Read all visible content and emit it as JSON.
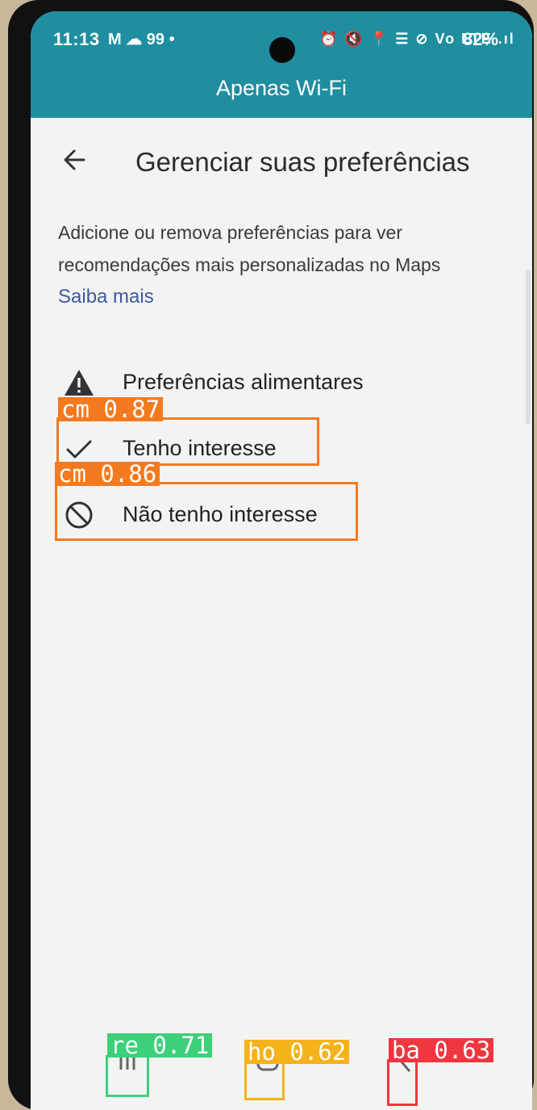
{
  "status_bar": {
    "time": "11:13",
    "notification_icons": "M ☁ 99 •",
    "system_icons": "⏰ 🔇 📍 ☰ ⊘ Vo LTE .ıl",
    "battery": "82%"
  },
  "app_bar": {
    "title": "Apenas Wi-Fi"
  },
  "header": {
    "title": "Gerenciar suas preferências"
  },
  "description": "Adicione ou remova preferências para ver recomendações mais personalizadas no Maps",
  "learn_more": "Saiba mais",
  "section": {
    "title": "Preferências alimentares",
    "icon": "warning-icon"
  },
  "options": [
    {
      "label": "Tenho interesse",
      "icon": "checkmark-icon"
    },
    {
      "label": "Não tenho interesse",
      "icon": "block-icon"
    }
  ],
  "nav_bar": {
    "recents_icon": "recents-icon",
    "home_icon": "home-icon",
    "back_icon": "back-nav-icon"
  },
  "detections": [
    {
      "tag": "cm 0.87",
      "color": "#f47a20"
    },
    {
      "tag": "cm 0.86",
      "color": "#f47a20"
    },
    {
      "tag": "re 0.71",
      "color": "#3dd07a"
    },
    {
      "tag": "ho 0.62",
      "color": "#f5b21b"
    },
    {
      "tag": "ba 0.63",
      "color": "#f0363f"
    }
  ]
}
